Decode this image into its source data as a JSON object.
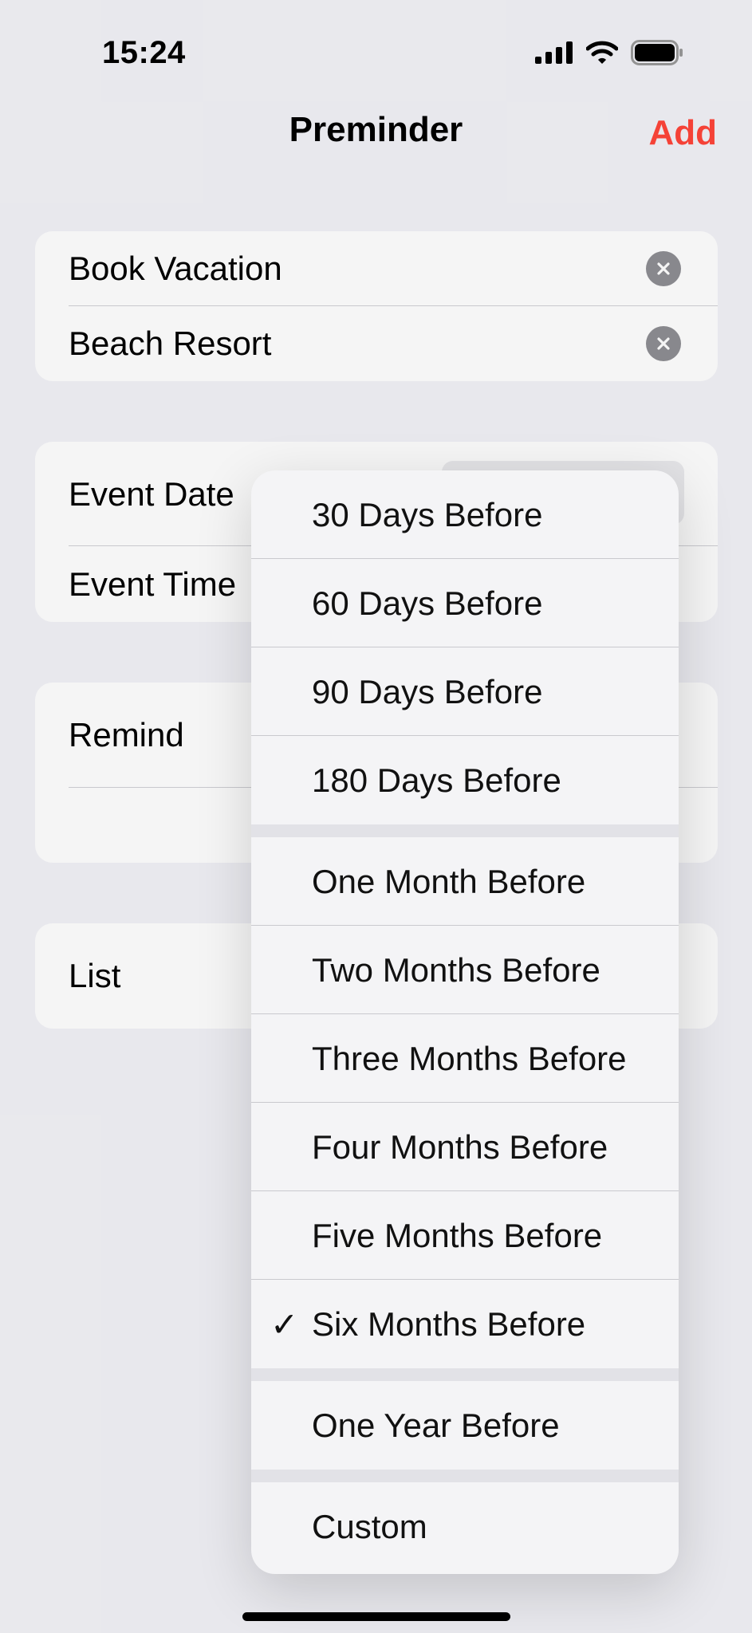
{
  "status_bar": {
    "time": "15:24"
  },
  "nav": {
    "title": "Preminder",
    "add_label": "Add"
  },
  "fields": [
    {
      "value": "Book Vacation"
    },
    {
      "value": "Beach Resort"
    }
  ],
  "date_section": {
    "event_date_label": "Event Date",
    "event_time_label": "Event Time"
  },
  "remind_section": {
    "remind_label": "Remind"
  },
  "list_section": {
    "list_label": "List"
  },
  "menu": {
    "groups": [
      [
        "30 Days Before",
        "60 Days Before",
        "90 Days Before",
        "180 Days Before"
      ],
      [
        "One Month Before",
        "Two Months Before",
        "Three Months Before",
        "Four Months Before",
        "Five Months Before",
        "Six Months Before"
      ],
      [
        "One Year Before"
      ],
      [
        "Custom"
      ]
    ],
    "selected": "Six Months Before"
  },
  "colors": {
    "accent": "#ff453a",
    "background": "#f2f2f7",
    "clear_button": "#8e8e93"
  },
  "icons": {
    "signal": "cellular-signal-icon",
    "wifi": "wifi-icon",
    "battery": "battery-icon",
    "clear": "clear-icon",
    "check": "checkmark-icon"
  }
}
